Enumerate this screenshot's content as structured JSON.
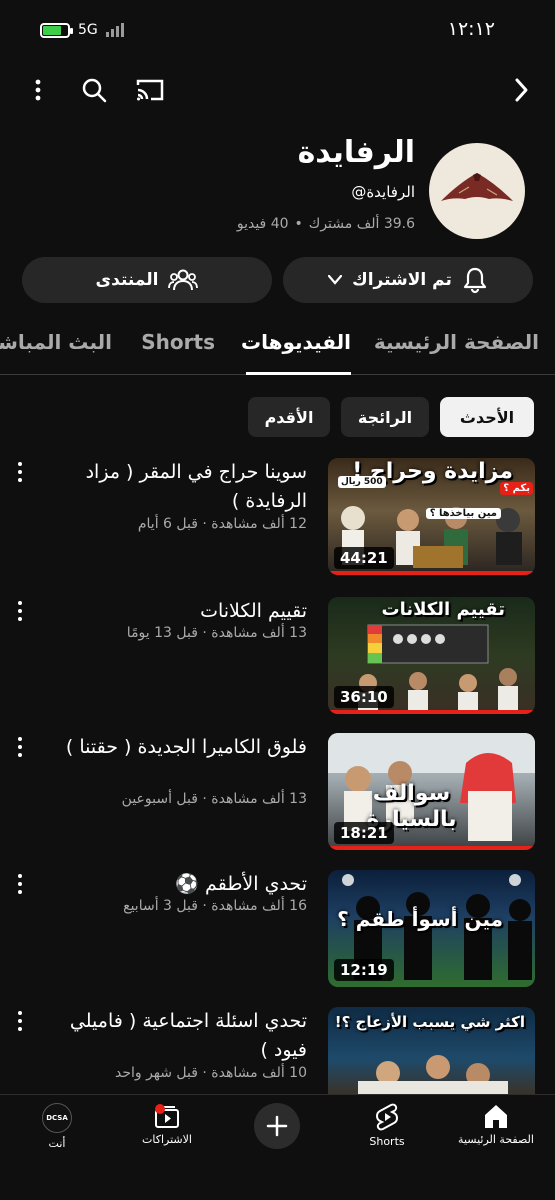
{
  "status_bar": {
    "time": "١٢:١٢",
    "network": "5G"
  },
  "channel": {
    "name": "الرفايدة",
    "handle": "@الرفايدة",
    "subscribers": "39.6 ألف مشترك",
    "videos_count": "40 فيديو"
  },
  "actions": {
    "subscribed_label": "تم الاشتراك",
    "community_label": "المنتدى"
  },
  "tabs": [
    {
      "label": "الصفحة الرئيسية"
    },
    {
      "label": "الفيديوهات"
    },
    {
      "label": "Shorts"
    },
    {
      "label": "البث المباشر"
    }
  ],
  "filters": [
    {
      "label": "الأحدث"
    },
    {
      "label": "الرائجة"
    },
    {
      "label": "الأقدم"
    }
  ],
  "videos": [
    {
      "title": "سوينا حراج في المقر ( مزاد الرفايدة )",
      "meta": "12 ألف مشاهدة · قبل 6 أيام",
      "duration": "44:21",
      "thumb_text": "مزايدة وحراج !",
      "thumb_sub": "مين بياخذها ؟",
      "thumb_tag": "بكم ؟",
      "thumb_price": "500 ريال"
    },
    {
      "title": "تقييم الكلانات",
      "meta": "13 ألف مشاهدة · قبل 13 يومًا",
      "duration": "36:10",
      "thumb_text": "تقييم الكلانات"
    },
    {
      "title": "فلوق الكاميرا الجديدة ( حقتنا )",
      "meta": "13 ألف مشاهدة · قبل أسبوعين",
      "duration": "18:21",
      "thumb_text": "سوالف بالسيارة"
    },
    {
      "title": "تحدي الأطقم ⚽",
      "meta": "16 ألف مشاهدة · قبل 3 أسابيع",
      "duration": "12:19",
      "thumb_text": "مين أسوأ طقم ؟"
    },
    {
      "title": "تحدي اسئلة اجتماعية ( فاميلي فيود )",
      "meta": "10 ألف مشاهدة · قبل شهر واحد",
      "thumb_text": "اكثر شي يسبب الأزعاج ؟!"
    }
  ],
  "bottom_nav": {
    "home": "الصفحة الرئيسية",
    "shorts": "Shorts",
    "subscriptions": "الاشتراكات",
    "you": "أنت",
    "avatar_text": "DCSA"
  }
}
